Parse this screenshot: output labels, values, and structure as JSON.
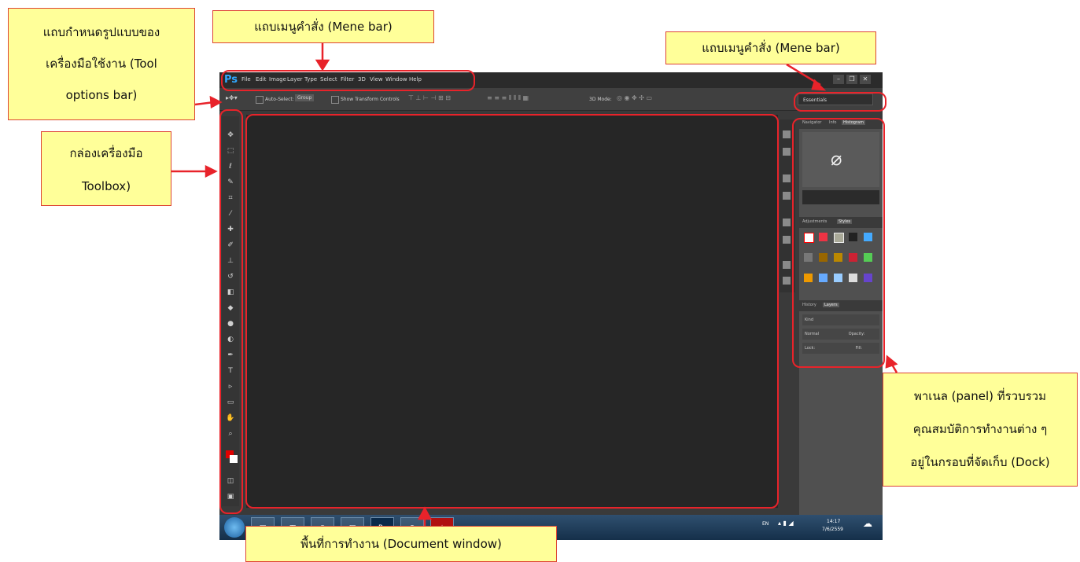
{
  "annotations": {
    "tool_options_line1": "แถบกำหนดรูปแบบของ",
    "tool_options_line2": "เครื่องมือใช้งาน (Tool",
    "tool_options_line3": "options bar)",
    "menu_bar_top": "แถบเมนูคำสั่ง (Mene bar)",
    "menu_bar_right": "แถบเมนูคำสั่ง (Mene bar)",
    "toolbox_line1": "กล่องเครื่องมือ",
    "toolbox_line2": "Toolbox)",
    "panel_line1": "พาเนล (panel) ที่รวบรวม",
    "panel_line2": "คุณสมบัติการทำงานต่าง ๆ",
    "panel_line3": "อยู่ในกรอบที่จัดเก็บ (Dock)",
    "document_window": "พื้นที่การทำงาน (Document window)"
  },
  "photoshop": {
    "logo": "Ps",
    "menu": [
      "File",
      "Edit",
      "Image",
      "Layer",
      "Type",
      "Select",
      "Filter",
      "3D",
      "View",
      "Window",
      "Help"
    ],
    "window_buttons": [
      "–",
      "❐",
      "✕"
    ],
    "options_bar": {
      "auto_select": "Auto-Select:",
      "group": "Group",
      "show_transform": "Show Transform Controls",
      "mode_3d": "3D Mode:",
      "workspace": "Essentials"
    },
    "panels": {
      "tabs_top": [
        "Navigator",
        "Info",
        "Histogram"
      ],
      "tabs_mid": [
        "Adjustments",
        "Styles"
      ],
      "tabs_bottom": [
        "History",
        "Layers"
      ],
      "layers_kind": "Kind",
      "layers_blend": "Normal",
      "layers_opacity": "Opacity:",
      "layers_lock": "Lock:",
      "layers_fill": "Fill:"
    },
    "taskbar": {
      "lang": "EN",
      "time": "14:17",
      "date": "7/6/2559"
    }
  }
}
